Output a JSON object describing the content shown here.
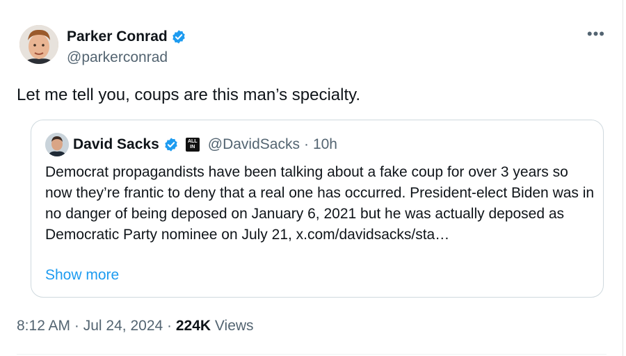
{
  "author": {
    "name": "Parker Conrad",
    "handle": "@parkerconrad",
    "verified": true
  },
  "tweet_text": "Let me tell you, coups are this man’s specialty.",
  "quoted_tweet": {
    "author_name": "David Sacks",
    "verified": true,
    "org_badge_text": "ALL IN",
    "handle": "@DavidSacks",
    "separator": "·",
    "time": "10h",
    "text": "Democrat propagandists have been talking about a fake coup for over 3 years so now they’re frantic to deny that a real one has occurred. President-elect Biden was in no danger of being deposed on January 6, 2021 but he was actually deposed as Democratic Party nominee on July 21, x.com/davidsacks/sta…",
    "show_more": "Show more"
  },
  "meta": {
    "time": "8:12 AM",
    "separator": "·",
    "date": "Jul 24, 2024",
    "views_count": "224K",
    "views_label": "Views"
  },
  "colors": {
    "accent": "#1d9bf0",
    "secondary_text": "#536471",
    "border": "#cfd9de"
  }
}
